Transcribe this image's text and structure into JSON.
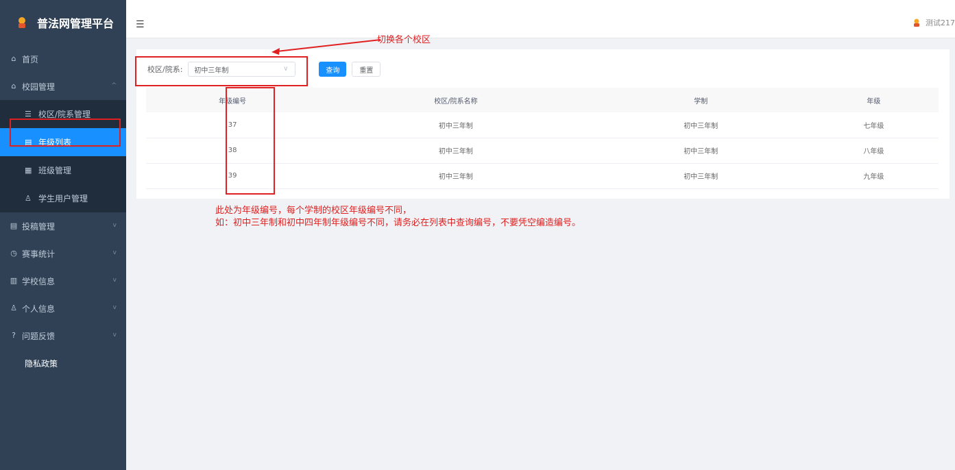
{
  "app": {
    "title": "普法网管理平台"
  },
  "sidebar": {
    "items": [
      {
        "label": "首页",
        "icon": "home-icon"
      },
      {
        "label": "校园管理",
        "icon": "home-icon",
        "expanded": true,
        "children": [
          {
            "label": "校区/院系管理",
            "icon": "list-icon"
          },
          {
            "label": "年级列表",
            "icon": "document-icon",
            "active": true
          },
          {
            "label": "班级管理",
            "icon": "class-icon"
          },
          {
            "label": "学生用户管理",
            "icon": "user-icon"
          }
        ]
      },
      {
        "label": "投稿管理",
        "icon": "document-icon"
      },
      {
        "label": "赛事统计",
        "icon": "clock-icon"
      },
      {
        "label": "学校信息",
        "icon": "building-icon"
      },
      {
        "label": "个人信息",
        "icon": "user-icon"
      },
      {
        "label": "问题反馈",
        "icon": "question-icon"
      },
      {
        "label": "隐私政策",
        "icon": ""
      }
    ]
  },
  "header": {
    "user": "测试217"
  },
  "filter": {
    "label": "校区/院系:",
    "selected": "初中三年制",
    "query_label": "查询",
    "reset_label": "重置"
  },
  "table": {
    "columns": [
      "年级编号",
      "校区/院系名称",
      "学制",
      "年级"
    ],
    "rows": [
      [
        "37",
        "初中三年制",
        "初中三年制",
        "七年级"
      ],
      [
        "38",
        "初中三年制",
        "初中三年制",
        "八年级"
      ],
      [
        "39",
        "初中三年制",
        "初中三年制",
        "九年级"
      ]
    ]
  },
  "annotations": {
    "switch_campus": "切换各个校区",
    "note_line1": "此处为年级编号，每个学制的校区年级编号不同，",
    "note_line2": "如：初中三年制和初中四年制年级编号不同，请务必在列表中查询编号，不要凭空编造编号。"
  },
  "colors": {
    "accent": "#1890ff",
    "annotation": "#e02020",
    "sidebar": "#304156"
  }
}
